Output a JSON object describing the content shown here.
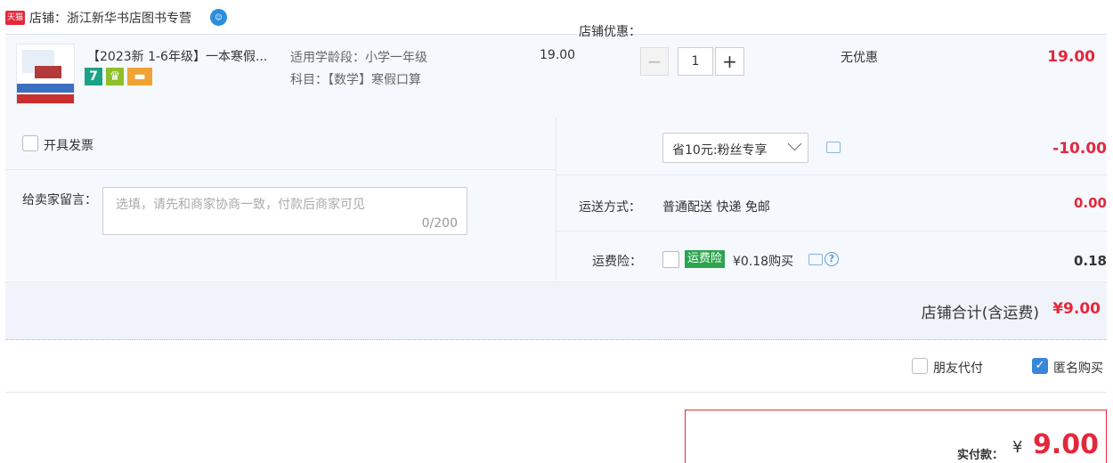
{
  "shop": {
    "badge": "天猫",
    "name": "店铺：浙江新华书店图书专营"
  },
  "item": {
    "title": "【2023新 1-6年级】一本寒假...",
    "badges": [
      "7"
    ],
    "sku_grade": "适用学龄段：小学一年级",
    "sku_subject": "科目：【数学】寒假口算",
    "unit_price": "19.00",
    "quantity": "1",
    "minus": "−",
    "plus": "+",
    "discount": "无优惠",
    "total": "19.00"
  },
  "invoice": {
    "label": "开具发票"
  },
  "message": {
    "label": "给卖家留言：",
    "placeholder": "选填，请先和商家协商一致，付款后商家可见",
    "counter": "0/200"
  },
  "shop_discount": {
    "label": "店铺优惠：",
    "selected": "省10元:粉丝专享",
    "amount": "-10.00"
  },
  "shipping": {
    "label": "运送方式：",
    "method": "普通配送 快递 免邮",
    "amount": "0.00"
  },
  "insurance": {
    "label": "运费险：",
    "badge": "运费险",
    "price": "¥0.18购买",
    "amount": "0.18"
  },
  "shop_total": {
    "label": "店铺合计(含运费)",
    "amount": "¥9.00"
  },
  "options": {
    "friend_pay": "朋友代付",
    "anonymous": "匿名购买",
    "anonymous_checked": true
  },
  "payment": {
    "label": "实付款：",
    "symbol": "¥",
    "amount": "9.00"
  },
  "colors": {
    "price_red": "#e4283b",
    "panel_bg": "#f5f8fd",
    "check_blue": "#3a86d9",
    "insurance_green": "#2da44e"
  }
}
